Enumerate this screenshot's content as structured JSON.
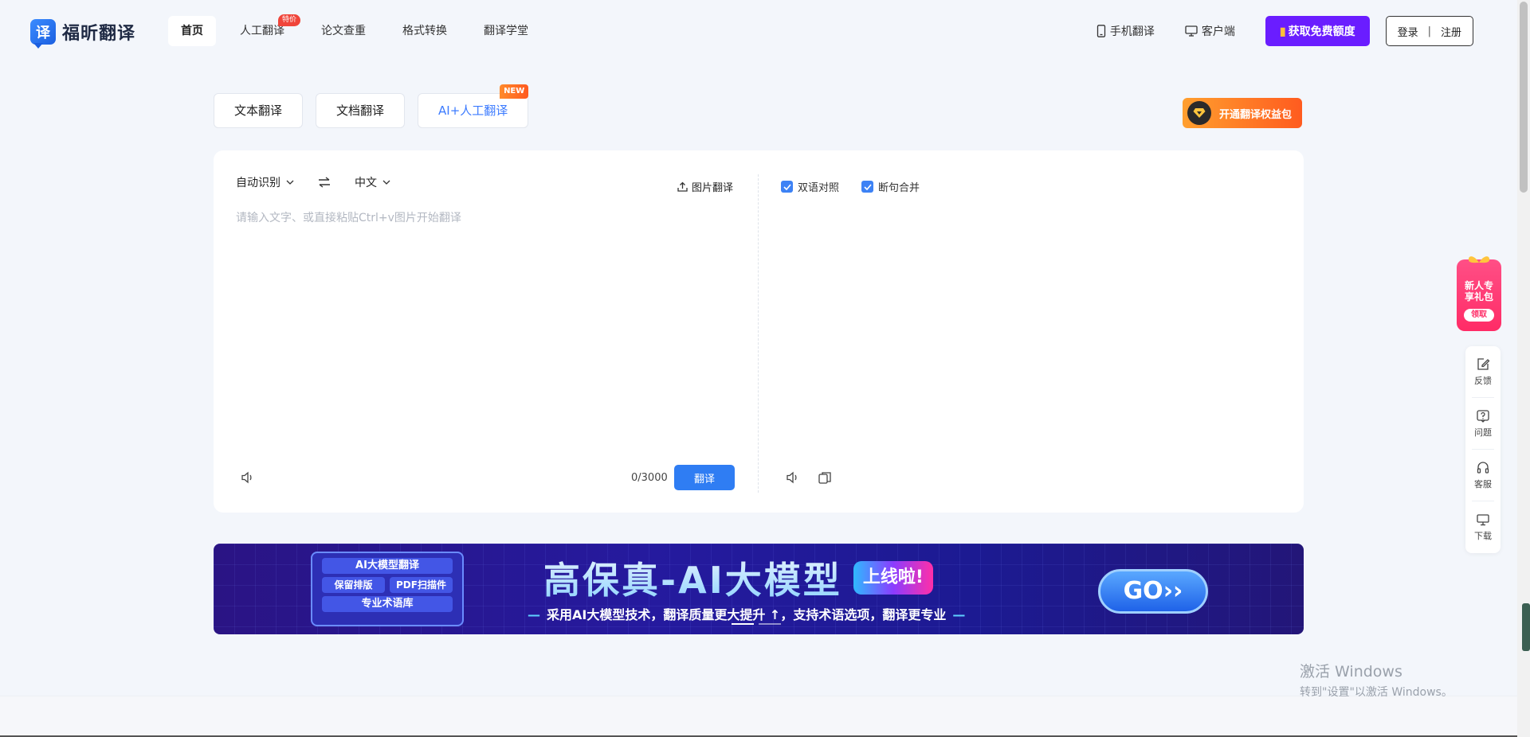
{
  "brand": {
    "logo_glyph": "译",
    "name": "福昕翻译"
  },
  "nav": {
    "items": [
      {
        "label": "首页",
        "active": true
      },
      {
        "label": "人工翻译",
        "badge": "特价"
      },
      {
        "label": "论文查重"
      },
      {
        "label": "格式转换"
      },
      {
        "label": "翻译学堂"
      }
    ]
  },
  "header_right": {
    "mobile_label": "手机翻译",
    "client_label": "客户端",
    "free_quota_label": "获取免费额度",
    "login_label": "登录",
    "separator": "|",
    "register_label": "注册"
  },
  "mode_tabs": [
    {
      "label": "文本翻译"
    },
    {
      "label": "文档翻译"
    },
    {
      "label": "AI+人工翻译",
      "badge": "NEW"
    }
  ],
  "vip_pack_label": "开通翻译权益包",
  "translator": {
    "source_lang": "自动识别",
    "target_lang": "中文",
    "image_translate_label": "图片翻译",
    "placeholder": "请输入文字、或直接粘贴Ctrl+v图片开始翻译",
    "char_count": "0/3000",
    "translate_button": "翻译",
    "options": [
      {
        "label": "双语对照",
        "checked": true
      },
      {
        "label": "断句合并",
        "checked": true
      }
    ]
  },
  "banner": {
    "chip_title": "AI大模型翻译",
    "chip_pills": [
      "保留排版",
      "PDF扫描件"
    ],
    "chip_bottom": "专业术语库",
    "headline": "高保真-AI大模型",
    "tag": "上线啦!",
    "subline": "采用AI大模型技术，翻译质量更大提升 ↑，支持术语选项，翻译更专业",
    "cta": "GO››",
    "dash": "—",
    "active_slide": 0,
    "slide_count": 2
  },
  "gift": {
    "text_line1": "新人专",
    "text_line2": "享礼包",
    "button": "领取"
  },
  "side_tools": [
    {
      "label": "反馈",
      "icon": "edit-icon"
    },
    {
      "label": "问题",
      "icon": "question-icon"
    },
    {
      "label": "客服",
      "icon": "headset-icon"
    },
    {
      "label": "下载",
      "icon": "monitor-icon"
    }
  ],
  "watermark": {
    "line1": "激活 Windows",
    "line2": "转到\"设置\"以激活 Windows。"
  },
  "colors": {
    "primary": "#2f7df3",
    "purple": "#6a1dff",
    "orange": "#ff5b1f",
    "pink": "#ff2b66"
  }
}
